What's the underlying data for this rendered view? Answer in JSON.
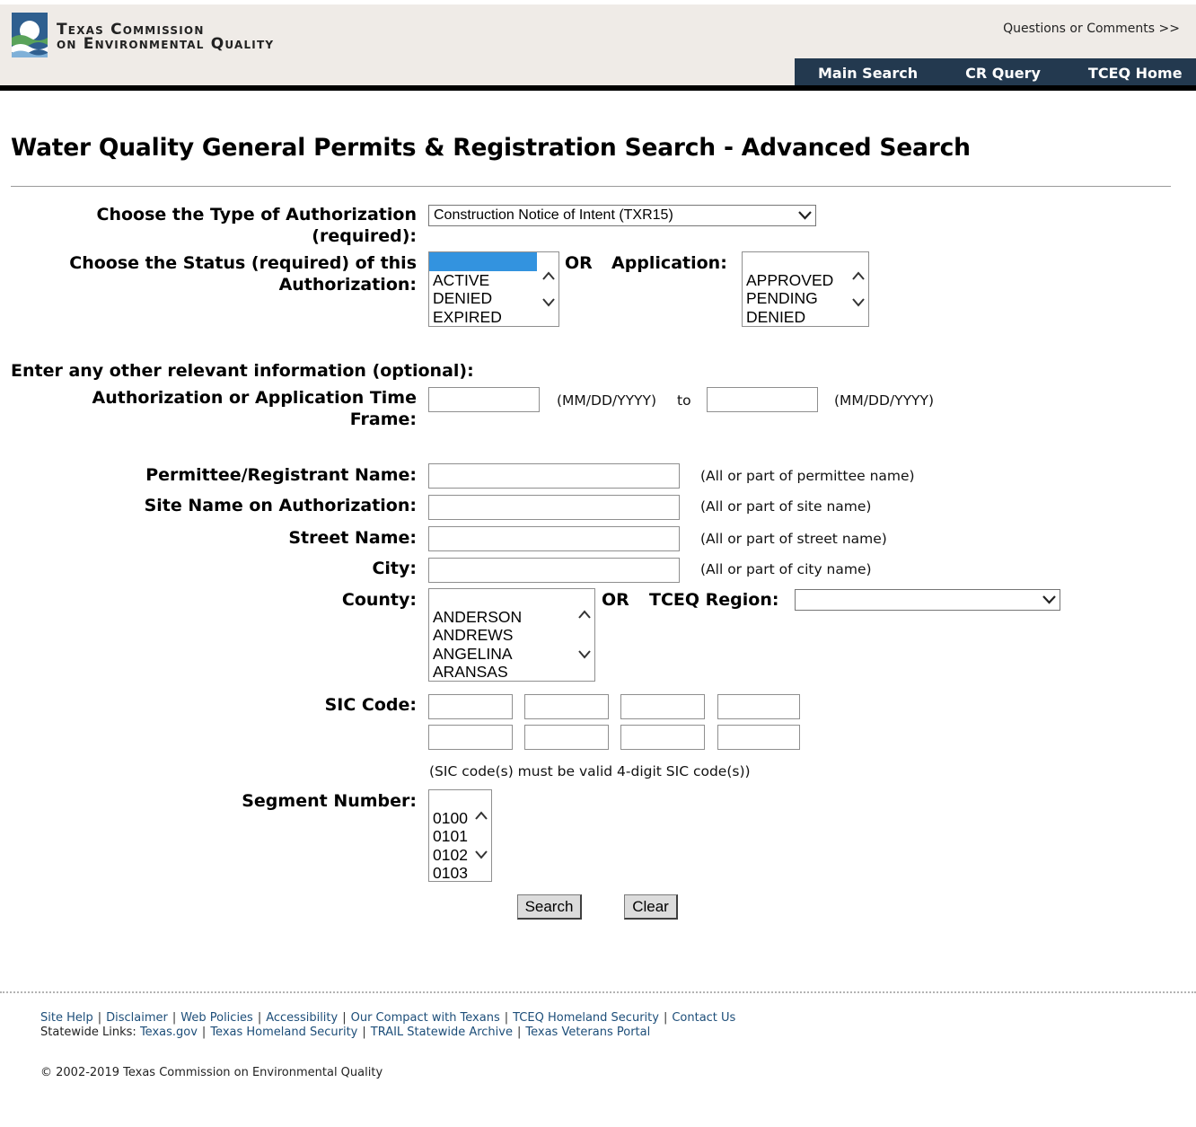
{
  "header": {
    "logo_line1": "Texas Commission",
    "logo_line2": "on Environmental Quality",
    "questions": "Questions or Comments >>",
    "nav": [
      "Main Search",
      "CR Query",
      "TCEQ Home"
    ]
  },
  "page_title": "Water Quality General Permits & Registration Search - Advanced Search",
  "form": {
    "auth_type_label_1": "Choose the Type of Authorization",
    "auth_type_label_2": "(required):",
    "auth_type_value": "Construction Notice of Intent (TXR15)",
    "status_label_1": "Choose the Status (required) of this",
    "status_label_2": "Authorization:",
    "status_options": [
      "",
      "ACTIVE",
      "DENIED",
      "EXPIRED"
    ],
    "or_1": "OR",
    "application_label": "Application:",
    "application_options": [
      "",
      "APPROVED",
      "PENDING",
      "DENIED"
    ],
    "optional_heading": "Enter any other relevant information (optional):",
    "timeframe_label_1": "Authorization or Application Time",
    "timeframe_label_2": "Frame:",
    "date_format_1": "(MM/DD/YYYY)",
    "to": "to",
    "date_format_2": "(MM/DD/YYYY)",
    "permittee_label": "Permittee/Registrant Name:",
    "permittee_hint": "(All or part of permittee name)",
    "site_label": "Site Name on Authorization:",
    "site_hint": "(All or part of site name)",
    "street_label": "Street Name:",
    "street_hint": "(All or part of street name)",
    "city_label": "City:",
    "city_hint": "(All or part of city name)",
    "county_label": "County:",
    "county_options": [
      "",
      "ANDERSON",
      "ANDREWS",
      "ANGELINA",
      "ARANSAS"
    ],
    "or_2": "OR",
    "region_label": "TCEQ Region:",
    "region_value": "",
    "sic_label": "SIC Code:",
    "sic_hint": "(SIC code(s) must be valid 4-digit SIC code(s))",
    "segment_label": "Segment Number:",
    "segment_options": [
      "",
      "0100",
      "0101",
      "0102",
      "0103"
    ],
    "search_button": "Search",
    "clear_button": "Clear"
  },
  "footer": {
    "links_row1": [
      "Site Help",
      "Disclaimer",
      "Web Policies",
      "Accessibility",
      "Our Compact with Texans",
      "TCEQ Homeland Security",
      "Contact Us"
    ],
    "statewide_label": "Statewide Links:",
    "links_row2": [
      "Texas.gov",
      "Texas Homeland Security",
      "TRAIL Statewide Archive",
      "Texas Veterans Portal"
    ],
    "copyright": "© 2002-2019 Texas Commission on Environmental Quality"
  },
  "colors": {
    "header_bg": "#efebe7",
    "nav_bg": "#23394f",
    "selected_option": "#3393df",
    "footer_link": "#1d4e79"
  }
}
